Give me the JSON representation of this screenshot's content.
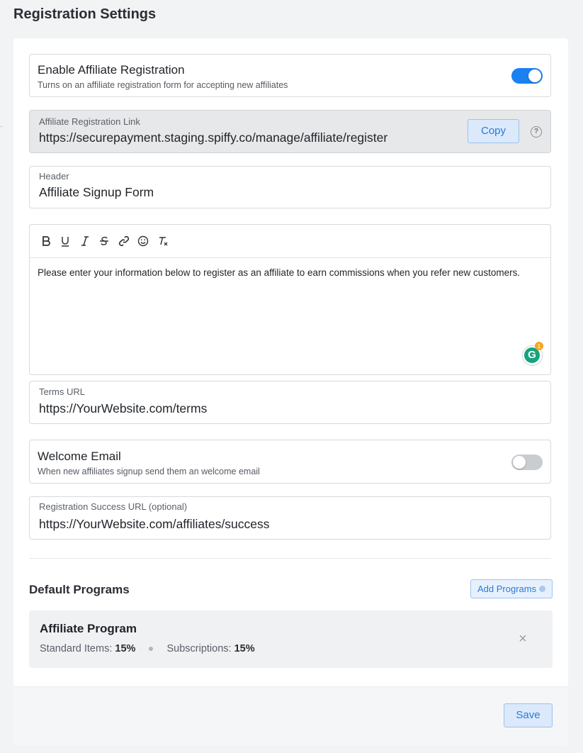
{
  "page": {
    "title": "Registration Settings"
  },
  "enable_registration": {
    "title": "Enable Affiliate Registration",
    "description": "Turns on an affiliate registration form for accepting new affiliates",
    "enabled": true
  },
  "registration_link": {
    "label": "Affiliate Registration Link",
    "value": "https://securepayment.staging.spiffy.co/manage/affiliate/register",
    "copy_label": "Copy",
    "help_icon": "?"
  },
  "header_field": {
    "label": "Header",
    "value": "Affiliate Signup Form"
  },
  "editor": {
    "toolbar": [
      "bold-icon",
      "underline-icon",
      "italic-icon",
      "strikethrough-icon",
      "link-icon",
      "emoji-icon",
      "clear-format-icon"
    ],
    "text": "Please enter your information below to register as an affiliate to earn commissions when you refer new customers.",
    "grammarly_letter": "G",
    "grammarly_count": "1"
  },
  "terms_field": {
    "label": "Terms URL",
    "value": "https://YourWebsite.com/terms"
  },
  "welcome_email": {
    "title": "Welcome Email",
    "description": "When new affiliates signup send them an welcome email",
    "enabled": false
  },
  "success_field": {
    "label": "Registration Success URL (optional)",
    "value": "https://YourWebsite.com/affiliates/success"
  },
  "default_programs": {
    "title": "Default Programs",
    "add_label": "Add Programs",
    "programs": [
      {
        "name": "Affiliate Program",
        "standard_label": "Standard Items:",
        "standard_value": "15%",
        "subscriptions_label": "Subscriptions:",
        "subscriptions_value": "15%"
      }
    ]
  },
  "footer": {
    "save_label": "Save"
  },
  "colors": {
    "accent": "#1a82f0",
    "button_bg": "#dbe9fb",
    "button_text": "#2a7ad8"
  }
}
